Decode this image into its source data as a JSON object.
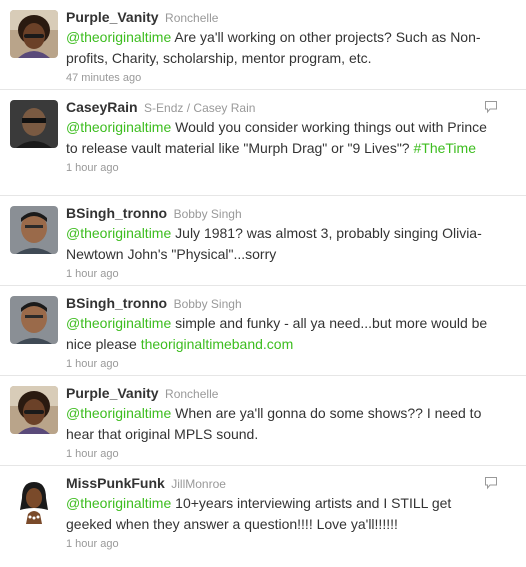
{
  "colors": {
    "link": "#3dbd1f",
    "screen_name": "#333333",
    "meta": "#999999"
  },
  "tweets": [
    {
      "screen_name": "Purple_Vanity",
      "full_name": "Ronchelle",
      "mention": "",
      "text": "@theoriginaltime Are ya'll working on other projects? Such as Non-profits, Charity, scholarship, mentor program, etc.",
      "mention_part": "@theoriginaltime",
      "body": " Are ya'll working on other projects? Such as Non-profits, Charity, scholarship, mentor program, etc.",
      "timestamp": "47 minutes ago",
      "avatar_icon": "woman-avatar-icon"
    },
    {
      "screen_name": "CaseyRain",
      "full_name": "S-Endz / Casey Rain",
      "mention_part": "@theoriginaltime",
      "body": " Would you consider working things out with Prince to release vault material like \"Murph Drag\" or \"9 Lives\"? ",
      "hashtag": "#TheTime",
      "timestamp": "1 hour ago",
      "avatar_icon": "man-avatar-icon"
    },
    {
      "screen_name": "BSingh_tronno",
      "full_name": "Bobby Singh",
      "mention_part": "@theoriginaltime",
      "body": " July 1981? was almost 3, probably singing Olivia-Newtown John's \"Physical\"...sorry",
      "timestamp": "1 hour ago",
      "avatar_icon": "man-avatar-icon"
    },
    {
      "screen_name": "BSingh_tronno",
      "full_name": "Bobby Singh",
      "mention_part": "@theoriginaltime",
      "body": " simple and funky - all ya need...but more would be nice please ",
      "link": "theoriginaltimeband.com",
      "timestamp": "1 hour ago",
      "avatar_icon": "man-avatar-icon"
    },
    {
      "screen_name": "Purple_Vanity",
      "full_name": "Ronchelle",
      "mention_part": "@theoriginaltime",
      "body": " When are ya'll gonna do some shows?? I need to hear that original MPLS sound.",
      "timestamp": "1 hour ago",
      "avatar_icon": "woman-avatar-icon"
    },
    {
      "screen_name": "MissPunkFunk",
      "full_name": "JillMonroe",
      "mention_part": "@theoriginaltime",
      "body": " 10+years interviewing artists and I STILL get geeked when they answer a question!!!! Love ya'll!!!!!!",
      "timestamp": "1 hour ago",
      "avatar_icon": "cartoon-woman-avatar-icon"
    }
  ]
}
